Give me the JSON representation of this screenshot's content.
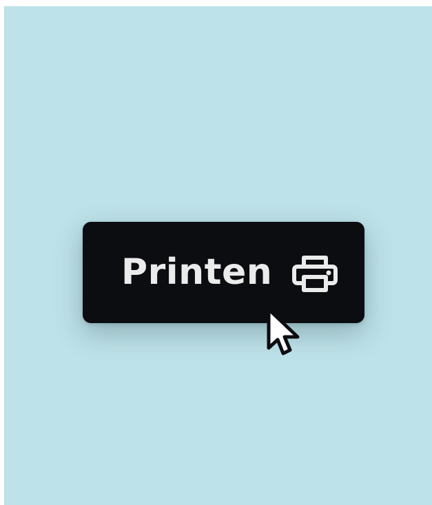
{
  "button": {
    "label": "Printen",
    "icon": "printer-icon"
  },
  "cursor": {
    "icon": "pointer-cursor-icon"
  },
  "colors": {
    "background": "#bee2e9",
    "button": "#0b0d10",
    "text": "#ebebeb"
  }
}
